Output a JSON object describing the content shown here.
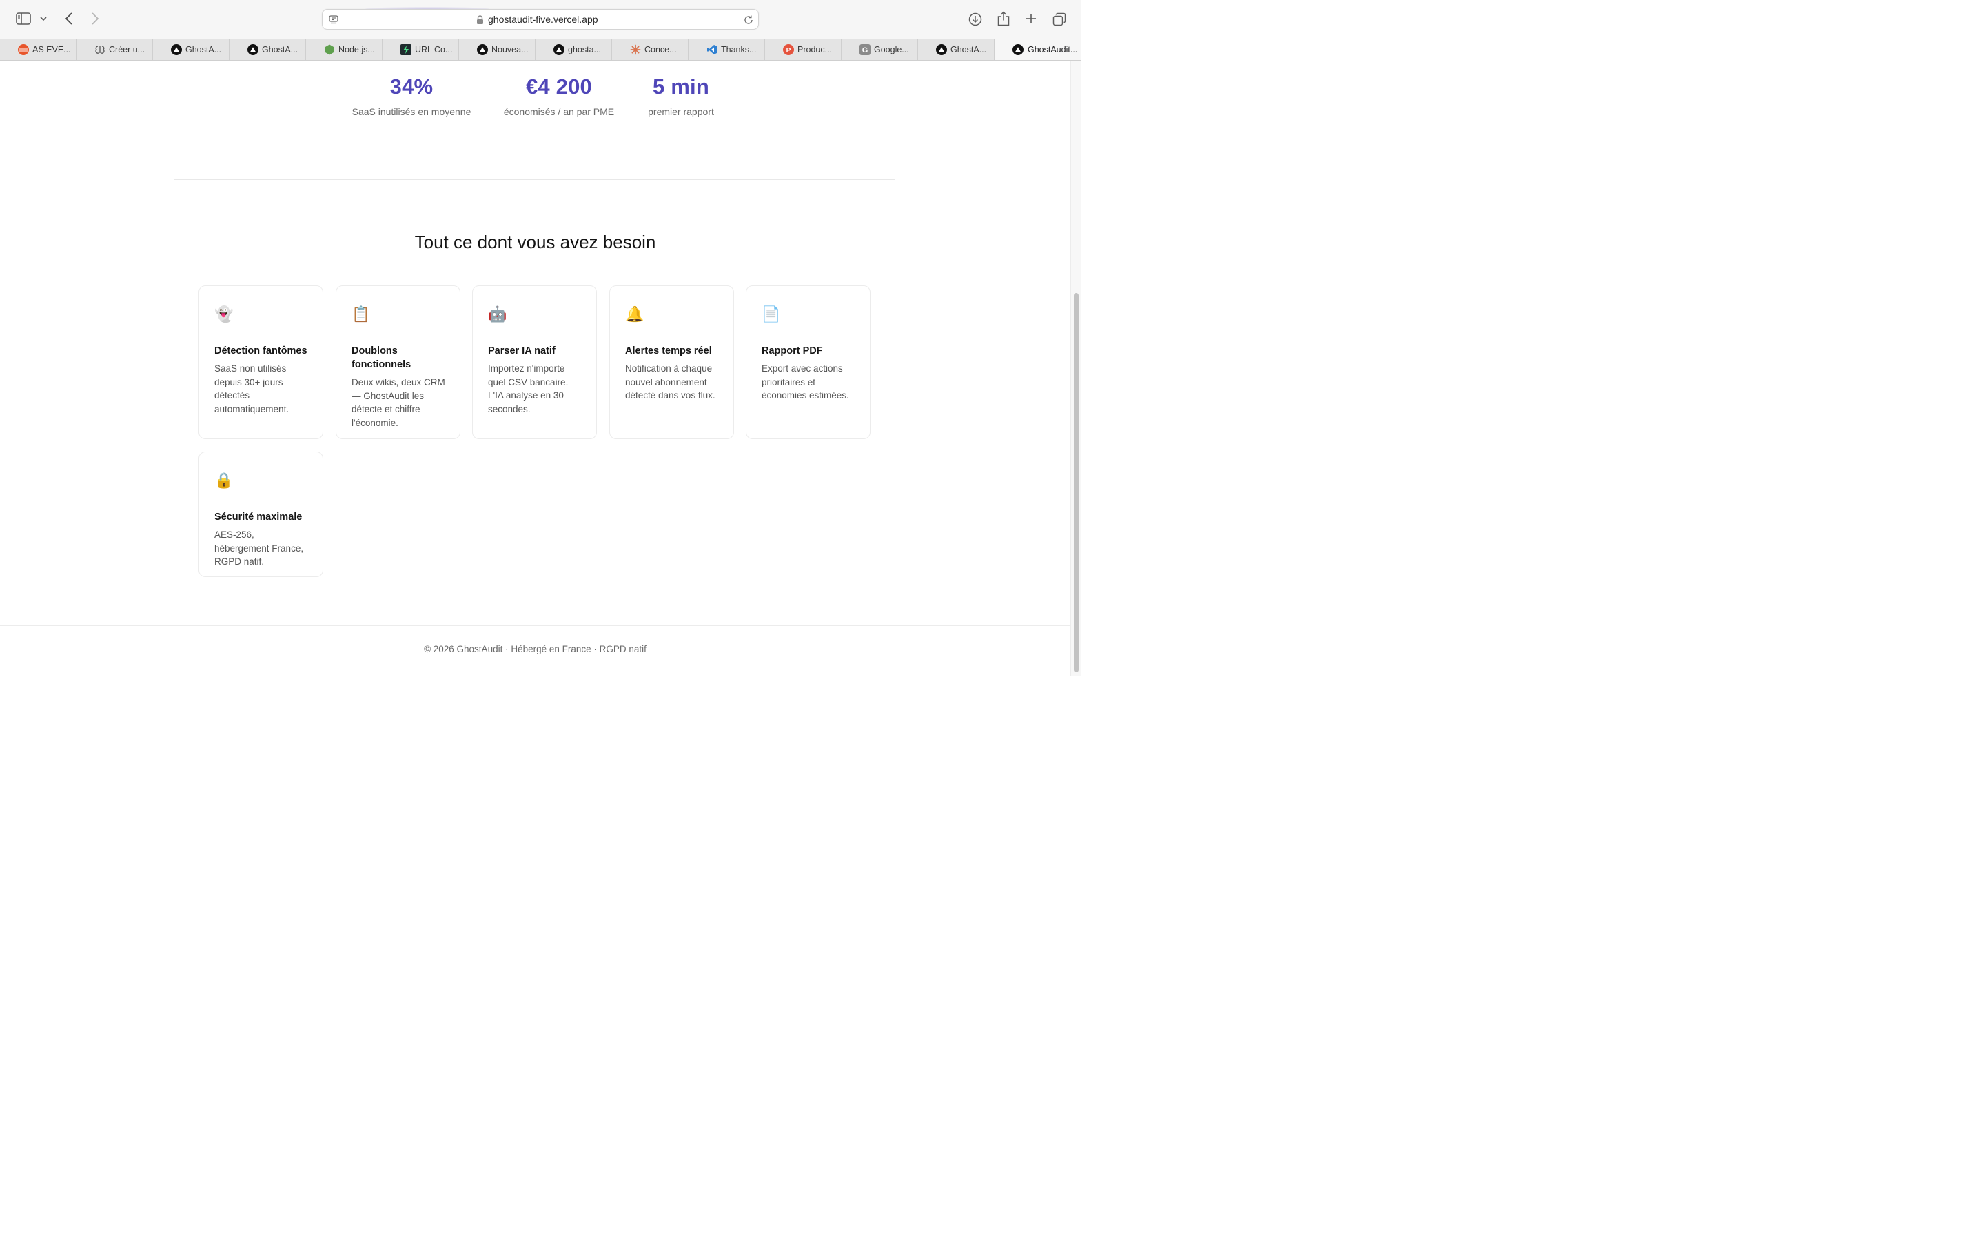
{
  "browser": {
    "url": "ghostaudit-five.vercel.app",
    "tabs": [
      {
        "label": "AS EVE...",
        "favicon": "orange-circle-icon",
        "color": "#e8552b"
      },
      {
        "label": "Créer u...",
        "favicon": "brain-icon",
        "color": "#555555"
      },
      {
        "label": "GhostA...",
        "favicon": "vercel-triangle-icon",
        "color": "#111111"
      },
      {
        "label": "GhostA...",
        "favicon": "vercel-triangle-icon",
        "color": "#111111"
      },
      {
        "label": "Node.js...",
        "favicon": "nodejs-hexagon-icon",
        "color": "#5fa04e"
      },
      {
        "label": "URL Co...",
        "favicon": "bolt-icon",
        "color": "#1f2a2e"
      },
      {
        "label": "Nouvea...",
        "favicon": "vercel-triangle-icon",
        "color": "#111111"
      },
      {
        "label": "ghosta...",
        "favicon": "vercel-triangle-icon",
        "color": "#111111"
      },
      {
        "label": "Conce...",
        "favicon": "claude-star-icon",
        "color": "#d9734e"
      },
      {
        "label": "Thanks...",
        "favicon": "vscode-icon",
        "color": "#2f80d1"
      },
      {
        "label": "Produc...",
        "favicon": "producthunt-icon",
        "color": "#e5533d"
      },
      {
        "label": "Google...",
        "favicon": "google-g-icon",
        "color": "#8a8a8a"
      },
      {
        "label": "GhostA...",
        "favicon": "vercel-triangle-icon",
        "color": "#111111"
      },
      {
        "label": "GhostAudit...",
        "favicon": "vercel-triangle-icon",
        "color": "#111111",
        "active": true
      }
    ]
  },
  "stats": [
    {
      "value": "34%",
      "label": "SaaS inutilisés en moyenne"
    },
    {
      "value": "€4 200",
      "label": "économisés / an par PME"
    },
    {
      "value": "5 min",
      "label": "premier rapport"
    }
  ],
  "features": {
    "title": "Tout ce dont vous avez besoin",
    "items": [
      {
        "icon": "👻",
        "icon_name": "ghost-icon",
        "title": "Détection fantômes",
        "desc": "SaaS non utilisés depuis 30+ jours détectés automatiquement."
      },
      {
        "icon": "📋",
        "icon_name": "clipboard-icon",
        "title": "Doublons fonctionnels",
        "desc": "Deux wikis, deux CRM — GhostAudit les détecte et chiffre l'économie."
      },
      {
        "icon": "🤖",
        "icon_name": "robot-icon",
        "title": "Parser IA natif",
        "desc": "Importez n'importe quel CSV bancaire. L'IA analyse en 30 secondes."
      },
      {
        "icon": "🔔",
        "icon_name": "bell-icon",
        "title": "Alertes temps réel",
        "desc": "Notification à chaque nouvel abonnement détecté dans vos flux."
      },
      {
        "icon": "📄",
        "icon_name": "document-icon",
        "title": "Rapport PDF",
        "desc": "Export avec actions prioritaires et économies estimées."
      },
      {
        "icon": "🔒",
        "icon_name": "lock-icon",
        "title": "Sécurité maximale",
        "desc": "AES-256, hébergement France, RGPD natif."
      }
    ]
  },
  "footer": {
    "text": "© 2026 GhostAudit · Hébergé en France · RGPD natif"
  },
  "colors": {
    "accent": "#4f46b8"
  }
}
